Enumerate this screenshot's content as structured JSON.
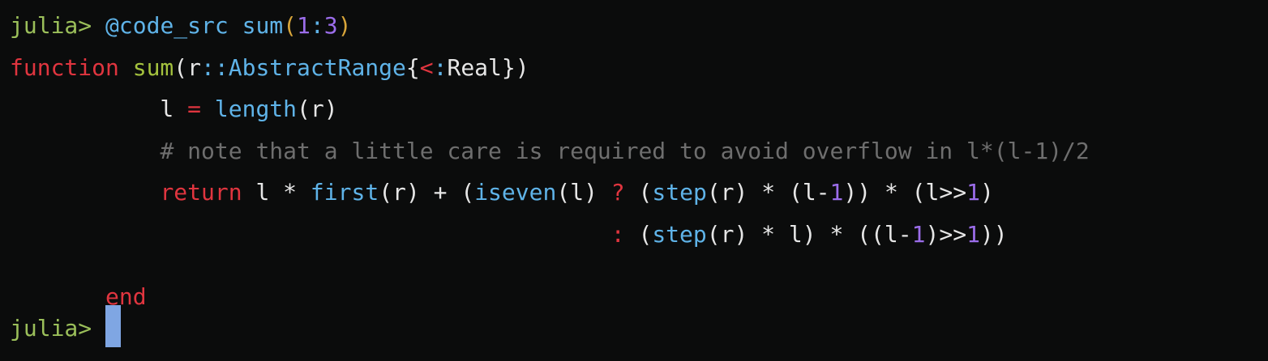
{
  "colors": {
    "background": "#0b0c0c",
    "prompt": "#9bbf5a",
    "keyword": "#e0353f",
    "function_name": "#a4c23e",
    "builtin": "#5fb3e8",
    "type": "#5fb3e8",
    "number": "#9b6dea",
    "comment": "#6e6e6e",
    "paren_highlight": "#d8a53a",
    "text": "#e6e6e6",
    "cursor": "#7fa6e3"
  },
  "lines": [
    [
      {
        "t": "julia> ",
        "c": "prompt"
      },
      {
        "t": "@code_src",
        "c": "builtin"
      },
      {
        "t": " ",
        "c": "text"
      },
      {
        "t": "sum",
        "c": "builtin"
      },
      {
        "t": "(",
        "c": "paren_highlight"
      },
      {
        "t": "1",
        "c": "number"
      },
      {
        "t": ":",
        "c": "builtin"
      },
      {
        "t": "3",
        "c": "number"
      },
      {
        "t": ")",
        "c": "paren_highlight"
      }
    ],
    [
      {
        "t": "function",
        "c": "keyword"
      },
      {
        "t": " ",
        "c": "text"
      },
      {
        "t": "sum",
        "c": "function_name"
      },
      {
        "t": "(r",
        "c": "text"
      },
      {
        "t": "::",
        "c": "builtin"
      },
      {
        "t": "AbstractRange",
        "c": "type"
      },
      {
        "t": "{",
        "c": "text"
      },
      {
        "t": "<",
        "c": "keyword"
      },
      {
        "t": ":",
        "c": "builtin"
      },
      {
        "t": "Real",
        "c": "text"
      },
      {
        "t": "})",
        "c": "text"
      }
    ],
    [
      {
        "t": "           l ",
        "c": "text"
      },
      {
        "t": "=",
        "c": "keyword"
      },
      {
        "t": " ",
        "c": "text"
      },
      {
        "t": "length",
        "c": "builtin"
      },
      {
        "t": "(r)",
        "c": "text"
      }
    ],
    [
      {
        "t": "           ",
        "c": "text"
      },
      {
        "t": "# note that a little care is required to avoid overflow in l*(l-1)/2",
        "c": "comment"
      }
    ],
    [
      {
        "t": "           ",
        "c": "text"
      },
      {
        "t": "return",
        "c": "keyword"
      },
      {
        "t": " l * ",
        "c": "text"
      },
      {
        "t": "first",
        "c": "builtin"
      },
      {
        "t": "(r) + (",
        "c": "text"
      },
      {
        "t": "iseven",
        "c": "builtin"
      },
      {
        "t": "(l) ",
        "c": "text"
      },
      {
        "t": "?",
        "c": "keyword"
      },
      {
        "t": " (",
        "c": "text"
      },
      {
        "t": "step",
        "c": "builtin"
      },
      {
        "t": "(r) * (l-",
        "c": "text"
      },
      {
        "t": "1",
        "c": "number"
      },
      {
        "t": ")) * (l>>",
        "c": "text"
      },
      {
        "t": "1",
        "c": "number"
      },
      {
        "t": ")",
        "c": "text"
      }
    ],
    [
      {
        "t": "                                            ",
        "c": "text"
      },
      {
        "t": ":",
        "c": "keyword"
      },
      {
        "t": " (",
        "c": "text"
      },
      {
        "t": "step",
        "c": "builtin"
      },
      {
        "t": "(r) * l) * ((l-",
        "c": "text"
      },
      {
        "t": "1",
        "c": "number"
      },
      {
        "t": ")>>",
        "c": "text"
      },
      {
        "t": "1",
        "c": "number"
      },
      {
        "t": "))",
        "c": "text"
      }
    ],
    [
      {
        "t": "",
        "c": "text"
      }
    ],
    [
      {
        "t": "       ",
        "c": "text"
      },
      {
        "t": "end",
        "c": "keyword"
      }
    ],
    [
      {
        "t": "julia> ",
        "c": "prompt"
      }
    ]
  ]
}
